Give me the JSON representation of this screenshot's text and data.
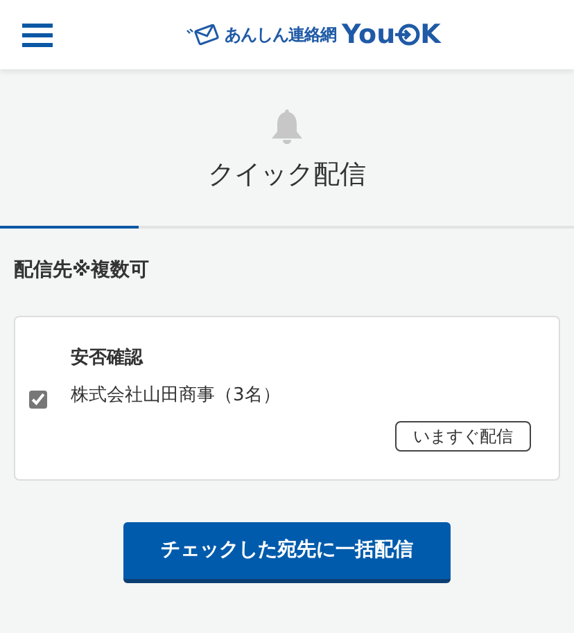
{
  "header": {
    "logo_text": "あんしん連絡網",
    "logo_brand_left": "You",
    "logo_brand_right": "K"
  },
  "page": {
    "title": "クイック配信"
  },
  "section": {
    "label": "配信先※複数可"
  },
  "groups": [
    {
      "title": "安否確認",
      "recipients": [
        {
          "name": "株式会社山田商事（3名）",
          "checked": true,
          "send_now": "いますぐ配信"
        }
      ]
    }
  ],
  "submit": {
    "label": "チェックした宛先に一括配信"
  }
}
